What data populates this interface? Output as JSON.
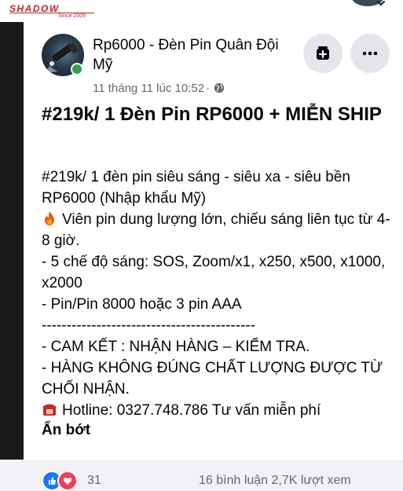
{
  "brand": {
    "logo_text": "SHADOW",
    "logo_tagline": "Since 2009"
  },
  "post": {
    "page_name": "Rp6000 - Đèn Pin Quân Đội Mỹ",
    "timestamp": "11 tháng 11 lúc 10:52",
    "separator": "·",
    "title": "#219k/ 1 Đèn Pin RP6000 + MIỄN SHIP",
    "body": {
      "line1_hashtag": "#219k",
      "line1_rest": "/ 1 đèn pin siêu sáng - siêu xa - siêu bền",
      "line2": "RP6000 (Nhập khẩu Mỹ)",
      "line3": "Viên pin dung lượng lớn, chiếu sáng liên tục từ 4-8 giờ.",
      "line4": "- 5 chế độ sáng: SOS, Zoom/x1, x250, x500, x1000, x2000",
      "line5": "- Pin/Pin 8000 hoặc 3 pin AAA",
      "line6": "-------------------------------------------",
      "line7": "- CAM KẾT : NHẬN HÀNG – KIỂM TRA.",
      "line8": "- HÀNG KHÔNG ĐÚNG CHẤT LƯỢNG ĐƯỢC TỪ CHỐI NHẬN.",
      "line9": "Hotline: 0327.748.786 Tư vấn miễn phí"
    },
    "see_less": "Ẩn bớt",
    "reaction_count": "31",
    "stats": "16 bình luận 2,7K lượt xem"
  },
  "icons": {
    "fire": "fire-icon",
    "phone": "telephone-icon",
    "globe": "globe-icon",
    "add": "add-bookmark-icon",
    "more": "more-options-icon"
  },
  "colors": {
    "brand_red": "#c0242b",
    "online_green": "#31a24c",
    "like_blue": "#1877f2",
    "love_red": "#f33e58",
    "secondary_text": "#65676b"
  }
}
